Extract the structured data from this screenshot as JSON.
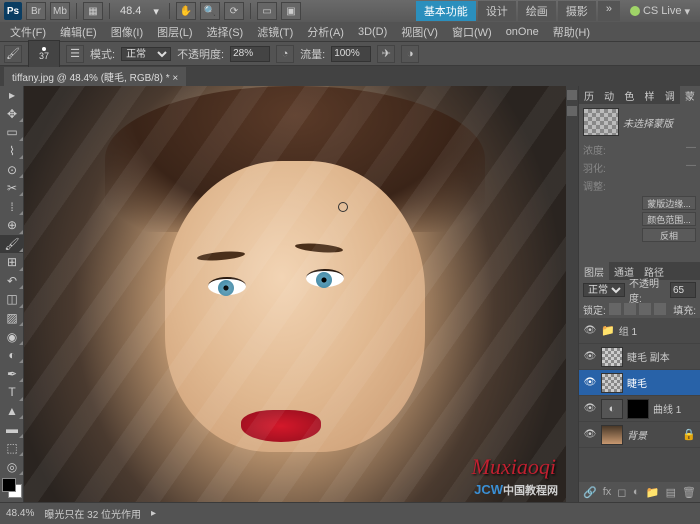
{
  "top": {
    "zoom": "48.4",
    "cslive": "CS Live"
  },
  "workspace": {
    "tabs": [
      "基本功能",
      "设计",
      "绘画",
      "摄影"
    ],
    "active": 0
  },
  "menu": [
    "文件(F)",
    "编辑(E)",
    "图像(I)",
    "图层(L)",
    "选择(S)",
    "滤镜(T)",
    "分析(A)",
    "3D(D)",
    "视图(V)",
    "窗口(W)",
    "onOne",
    "帮助(H)"
  ],
  "options": {
    "brush_size": "37",
    "mode_label": "模式:",
    "mode_value": "正常",
    "opacity_label": "不透明度:",
    "opacity_value": "28%",
    "flow_label": "流量:",
    "flow_value": "100%"
  },
  "doc_tab": "tiffany.jpg @ 48.4% (睫毛, RGB/8) * ×",
  "panels1": {
    "tabs": [
      "历史",
      "动作",
      "色板",
      "样式",
      "调整",
      "蒙版"
    ],
    "active": 5,
    "mask_title": "未选择蒙版",
    "density_label": "浓度:",
    "feather_label": "羽化:",
    "adjust_label": "调整:",
    "btn1": "蒙版边缘...",
    "btn2": "颜色范围...",
    "btn3": "反相"
  },
  "layers": {
    "tabs": [
      "图层",
      "通道",
      "路径"
    ],
    "active": 0,
    "blend": "正常",
    "opacity_label": "不透明度:",
    "opacity_value": "65",
    "lock_label": "锁定:",
    "fill_label": "填充:",
    "items": [
      {
        "name": "组 1",
        "group": true
      },
      {
        "name": "睫毛 副本"
      },
      {
        "name": "睫毛",
        "selected": true
      },
      {
        "name": "曲线 1",
        "adj": true
      },
      {
        "name": "背景",
        "bg": true
      }
    ]
  },
  "status": {
    "zoom": "48.4%",
    "info": "曝光只在 32 位光作用"
  },
  "watermark": {
    "sig": "Muxiaoqi",
    "site": "JCW",
    "cn": "中国教程网"
  }
}
